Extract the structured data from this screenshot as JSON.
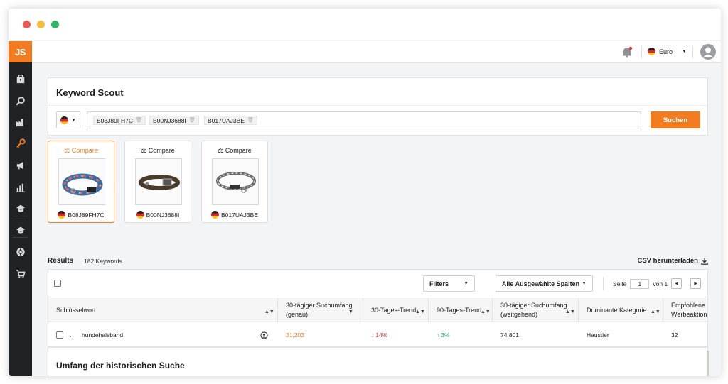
{
  "app": {
    "logo_text": "JS"
  },
  "sidebar": {
    "items": [
      {
        "name": "product-database-icon"
      },
      {
        "name": "product-tracker-icon"
      },
      {
        "name": "supplier-database-icon"
      },
      {
        "name": "keyword-scout-icon",
        "active": true
      },
      {
        "name": "promotions-icon"
      },
      {
        "name": "sales-analytics-icon"
      },
      {
        "name": "academy-icon"
      },
      {
        "name": "university-icon"
      },
      {
        "name": "marketplace-icon"
      },
      {
        "name": "cart-icon"
      }
    ]
  },
  "topbar": {
    "currency": "Euro"
  },
  "scout": {
    "title": "Keyword Scout",
    "chips": [
      "B08J89FH7C",
      "B00NJ3688I",
      "B017UAJ3BE"
    ],
    "search_label": "Suchen"
  },
  "cards": [
    {
      "compare": "Compare",
      "asin": "B08J89FH7C",
      "active": true
    },
    {
      "compare": "Compare",
      "asin": "B00NJ3688I",
      "active": false
    },
    {
      "compare": "Compare",
      "asin": "B017UAJ3BE",
      "active": false
    }
  ],
  "results": {
    "title": "Results",
    "count": "182 Keywords",
    "csv": "CSV herunterladen"
  },
  "toolbar": {
    "filters": "Filters",
    "columns": "Alle Ausgewählte Spalten",
    "page_label": "Seite",
    "page_value": "1",
    "page_of": "von 1"
  },
  "table": {
    "headers": [
      "Schlüsselwort",
      "30-tägiger Suchumfang (genau)",
      "30-Tages-Trend",
      "90-Tages-Trend",
      "30-tägiger Suchumfang (weitgehend)",
      "Dominante Kategorie",
      "Empfohlene Werbeaktion"
    ],
    "rows": [
      {
        "keyword": "hundehalsband",
        "exact": "31,203",
        "trend30": "14%",
        "trend90": "3%",
        "broad": "74,801",
        "category": "Haustier",
        "recommended": "32"
      }
    ]
  },
  "history": {
    "title": "Umfang der historischen Suche"
  },
  "colors": {
    "accent": "#f47c20",
    "sidebar": "#202326",
    "down": "#e0383e",
    "up": "#1fae5f"
  }
}
